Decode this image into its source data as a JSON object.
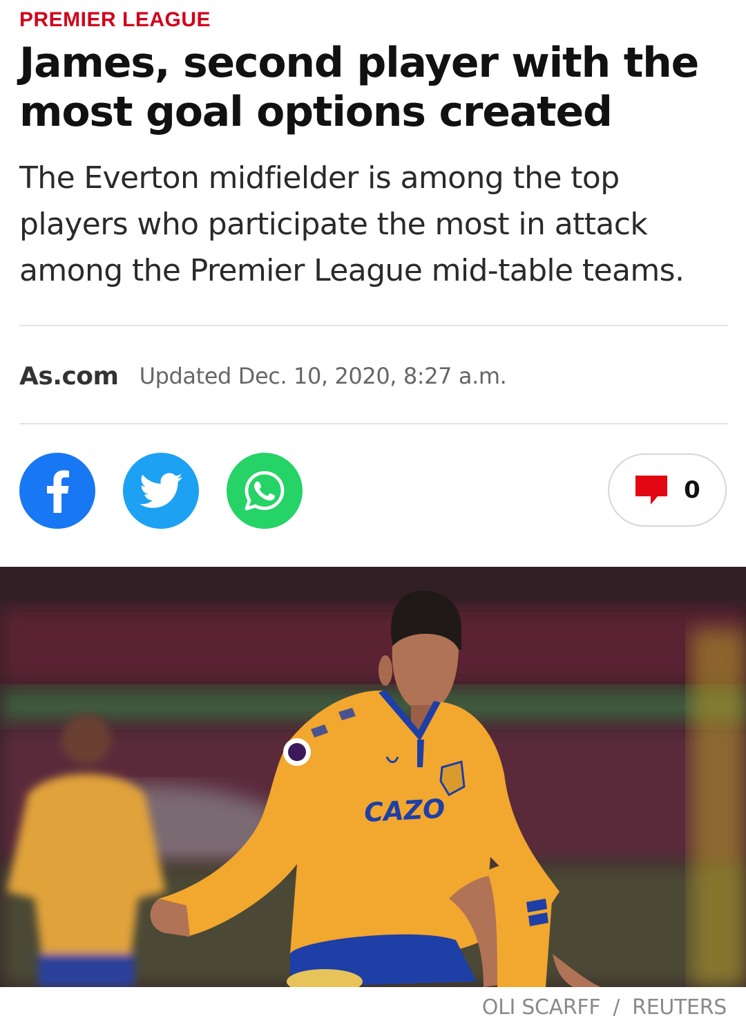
{
  "article": {
    "section": "PREMIER LEAGUE",
    "headline": "James, second player with the most goal options created",
    "summary": "The Everton midfielder is among the top players who participate the most in attack among the Premier League mid-table teams.",
    "source": "As.com",
    "updated": "Updated Dec. 10, 2020, 8:27 a.m."
  },
  "share": {
    "facebook_icon": "facebook-icon",
    "twitter_icon": "twitter-icon",
    "whatsapp_icon": "whatsapp-icon"
  },
  "comments": {
    "icon": "comment-icon",
    "count": "0"
  },
  "photo": {
    "kit_sponsor": "CAZO",
    "credit_photographer": "OLI SCARFF",
    "credit_separator": "/",
    "credit_agency": "REUTERS"
  },
  "colors": {
    "section_red": "#d0021b",
    "facebook": "#1877f2",
    "twitter": "#1da1f2",
    "whatsapp": "#25d366",
    "comment_icon": "#e30613"
  }
}
